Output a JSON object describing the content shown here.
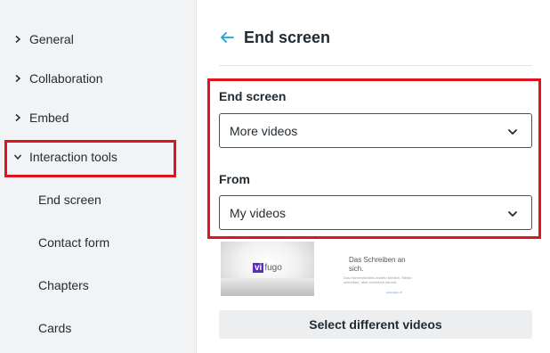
{
  "sidebar": {
    "items": [
      {
        "label": "General",
        "expanded": false,
        "icon": "chevron-right-icon"
      },
      {
        "label": "Collaboration",
        "expanded": false,
        "icon": "chevron-right-icon"
      },
      {
        "label": "Embed",
        "expanded": false,
        "icon": "chevron-right-icon"
      },
      {
        "label": "Interaction tools",
        "expanded": true,
        "icon": "chevron-down-icon"
      }
    ],
    "subitems": [
      "End screen",
      "Contact form",
      "Chapters",
      "Cards"
    ]
  },
  "header": {
    "title": "End screen",
    "back_icon": "arrow-left-icon"
  },
  "form": {
    "end_screen_label": "End screen",
    "end_screen_value": "More videos",
    "from_label": "From",
    "from_value": "My videos"
  },
  "thumbnails": {
    "logo_v": "vi",
    "logo_rest": "fugo",
    "text_title": "Das Schreiben an sich.",
    "text_body": "Das Hörverständnis andere Medien. Stefan schreiben, aber schreiben kannst.",
    "text_footer": "www.vigilo.ch"
  },
  "actions": {
    "select_videos_label": "Select different videos"
  },
  "colors": {
    "highlight": "#e0141e",
    "accent": "#1aa3d9",
    "sidebar_bg": "#f2f3f4"
  }
}
